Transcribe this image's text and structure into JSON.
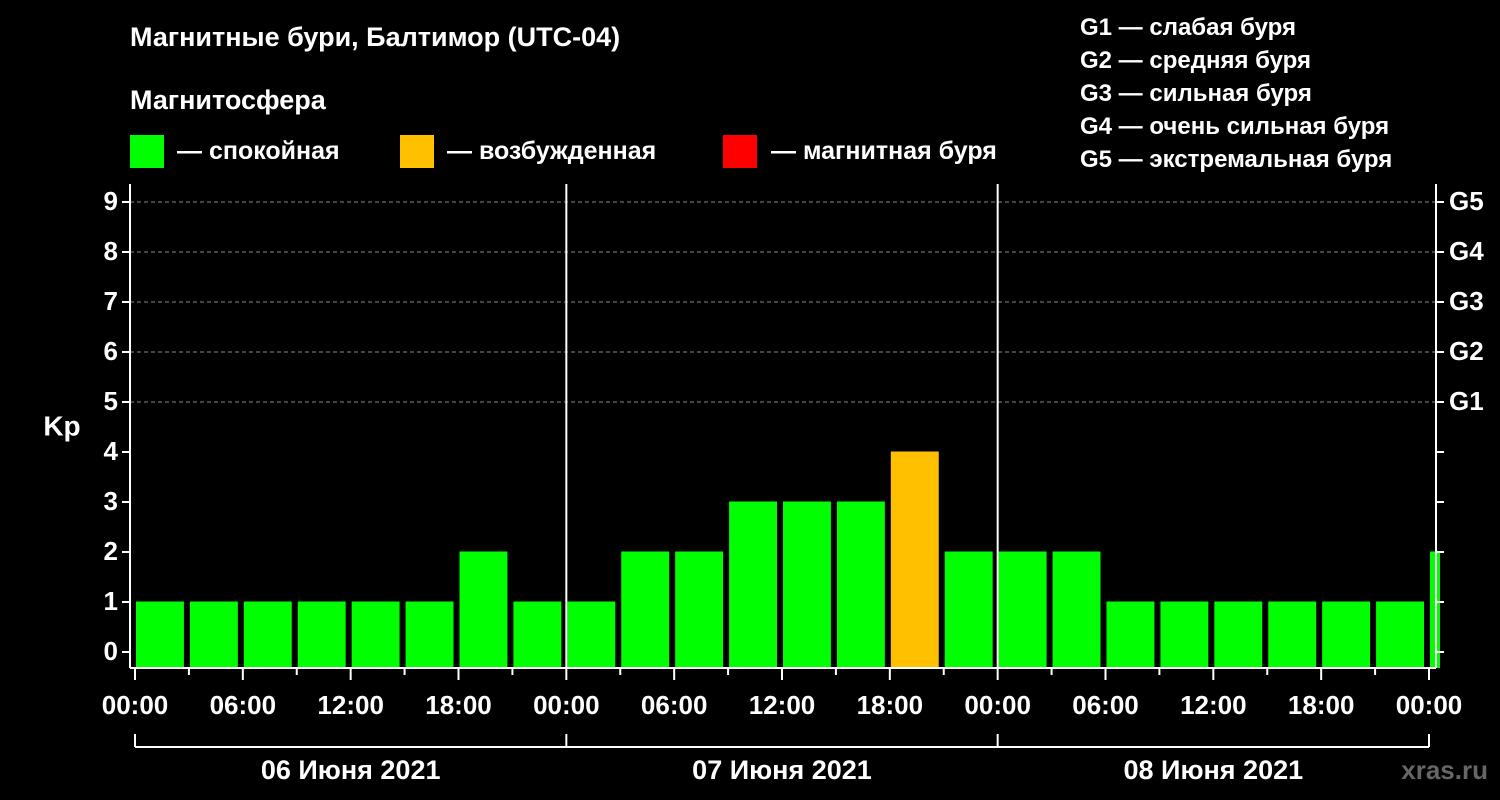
{
  "chart_data": {
    "type": "bar",
    "title": "Магнитные бури, Балтимор (UTC-04)",
    "subtitle": "Магнитосфера",
    "ylabel": "Kp",
    "ylim": [
      0,
      9
    ],
    "y_ticks": [
      "0",
      "1",
      "2",
      "3",
      "4",
      "5",
      "6",
      "7",
      "8",
      "9"
    ],
    "right_ticks": [
      {
        "y": 5,
        "label": "G1"
      },
      {
        "y": 6,
        "label": "G2"
      },
      {
        "y": 7,
        "label": "G3"
      },
      {
        "y": 8,
        "label": "G4"
      },
      {
        "y": 9,
        "label": "G5"
      }
    ],
    "x_tick_labels": [
      "00:00",
      "06:00",
      "12:00",
      "18:00",
      "00:00",
      "06:00",
      "12:00",
      "18:00",
      "00:00",
      "06:00",
      "12:00",
      "18:00",
      "00:00"
    ],
    "days": [
      "06 Июня 2021",
      "07 Июня 2021",
      "08 Июня 2021"
    ],
    "bars": [
      {
        "start_hour": 0,
        "value": 1
      },
      {
        "start_hour": 3,
        "value": 1
      },
      {
        "start_hour": 6,
        "value": 1
      },
      {
        "start_hour": 9,
        "value": 1
      },
      {
        "start_hour": 12,
        "value": 1
      },
      {
        "start_hour": 15,
        "value": 1
      },
      {
        "start_hour": 18,
        "value": 2
      },
      {
        "start_hour": 21,
        "value": 1
      },
      {
        "start_hour": 24,
        "value": 1
      },
      {
        "start_hour": 27,
        "value": 2
      },
      {
        "start_hour": 30,
        "value": 2
      },
      {
        "start_hour": 33,
        "value": 3
      },
      {
        "start_hour": 36,
        "value": 3
      },
      {
        "start_hour": 39,
        "value": 3
      },
      {
        "start_hour": 42,
        "value": 4
      },
      {
        "start_hour": 45,
        "value": 2
      },
      {
        "start_hour": 48,
        "value": 2
      },
      {
        "start_hour": 51,
        "value": 2
      },
      {
        "start_hour": 54,
        "value": 1
      },
      {
        "start_hour": 57,
        "value": 1
      },
      {
        "start_hour": 60,
        "value": 1
      },
      {
        "start_hour": 63,
        "value": 1
      },
      {
        "start_hour": 66,
        "value": 1
      },
      {
        "start_hour": 69,
        "value": 1
      },
      {
        "start_hour": 72,
        "value": 2
      }
    ],
    "x_range_hours": [
      0,
      72
    ],
    "grid": "dashed at 5-9",
    "colors": {
      "quiet": "#00ff00",
      "excited": "#ffc000",
      "storm": "#ff0000",
      "background": "#000000",
      "axis": "#ffffff"
    },
    "legend": {
      "states": [
        {
          "label": "— спокойная",
          "color": "#00ff00"
        },
        {
          "label": "— возбужденная",
          "color": "#ffc000"
        },
        {
          "label": "— магнитная буря",
          "color": "#ff0000"
        }
      ],
      "storm_levels": [
        "G1 — слабая буря",
        "G2 — средняя буря",
        "G3 — сильная буря",
        "G4 — очень сильная буря",
        "G5 — экстремальная буря"
      ]
    }
  },
  "watermark": "xras.ru"
}
